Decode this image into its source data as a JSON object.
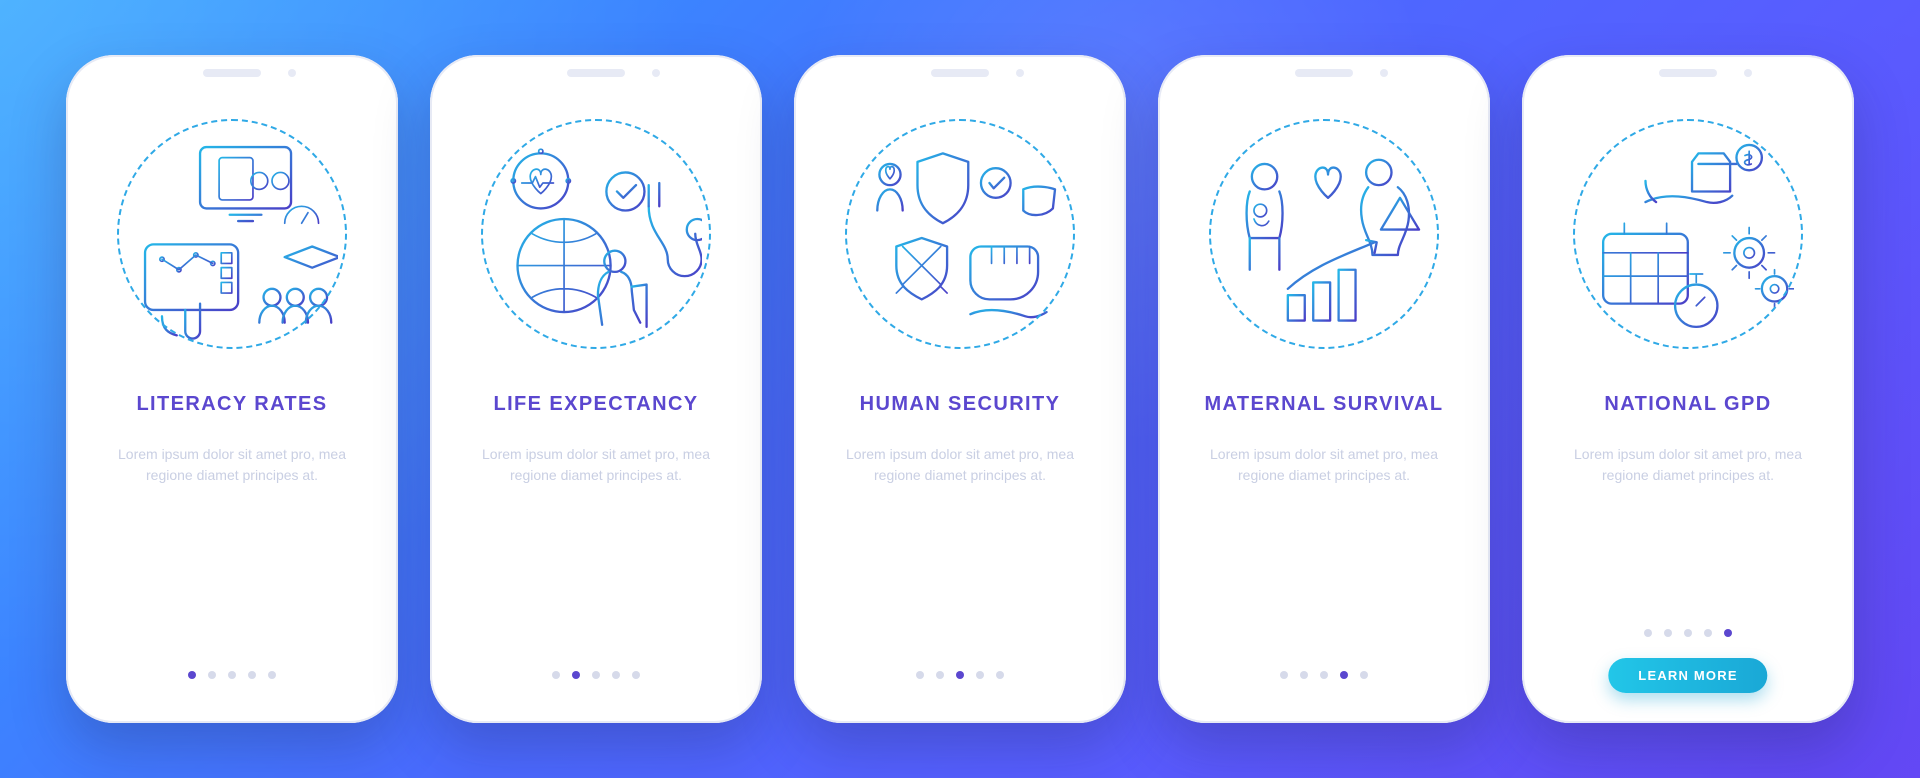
{
  "common": {
    "cta_label": "LEARN MORE",
    "lorem": "Lorem ipsum dolor sit amet pro, mea regione diamet principes at."
  },
  "slides": [
    {
      "title": "LITERACY RATES",
      "desc_ref": "common.lorem",
      "active": 0
    },
    {
      "title": "LIFE EXPECTANCY",
      "desc_ref": "common.lorem",
      "active": 1
    },
    {
      "title": "HUMAN SECURITY",
      "desc_ref": "common.lorem",
      "active": 2
    },
    {
      "title": "MATERNAL SURVIVAL",
      "desc_ref": "common.lorem",
      "active": 3
    },
    {
      "title": "NATIONAL GPD",
      "desc_ref": "common.lorem",
      "active": 4,
      "cta": true
    }
  ],
  "num_dots": 5
}
